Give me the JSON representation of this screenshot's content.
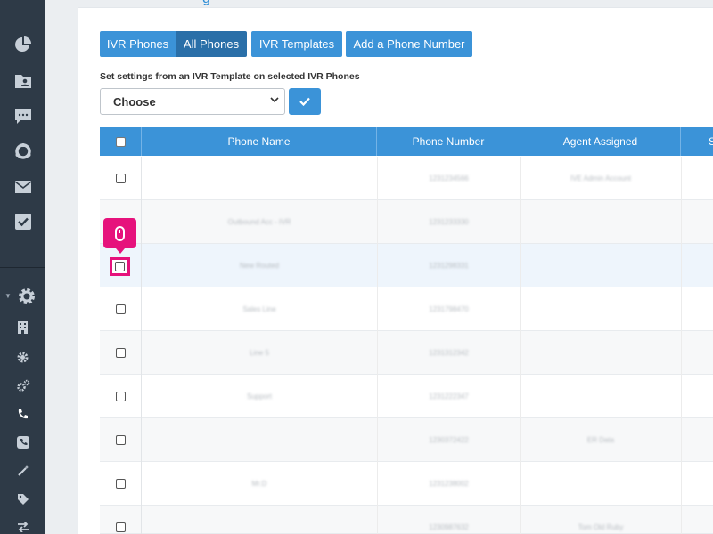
{
  "tabs": {
    "ivr_phones": "IVR Phones",
    "all_phones": "All Phones",
    "ivr_templates": "IVR Templates",
    "add_phone": "Add a Phone Number"
  },
  "settings": {
    "label": "Set settings from an IVR Template on selected IVR Phones",
    "select_value": "Choose"
  },
  "table": {
    "columns": [
      "Phone Name",
      "Phone Number",
      "Agent Assigned",
      "S"
    ],
    "rows": [
      {
        "name": "",
        "number": "1231234566",
        "agent": "IVE Admin Account"
      },
      {
        "name": "Outbound Acc - IVR",
        "number": "1231233330",
        "agent": ""
      },
      {
        "name": "New Routed",
        "number": "1231298331",
        "agent": ""
      },
      {
        "name": "Sales Line",
        "number": "1231798470",
        "agent": ""
      },
      {
        "name": "Line 5",
        "number": "1231312342",
        "agent": ""
      },
      {
        "name": "Support",
        "number": "1231222347",
        "agent": ""
      },
      {
        "name": "",
        "number": "1230372422",
        "agent": "ER Data"
      },
      {
        "name": "Mr.D",
        "number": "1231238002",
        "agent": ""
      },
      {
        "name": "",
        "number": "1230987632",
        "agent": "Tom Old Ruby"
      }
    ]
  },
  "sidebar": {
    "icons": [
      "pie-chart-icon",
      "contacts-folder-icon",
      "chat-icon",
      "lifebuoy-icon",
      "mail-icon",
      "checkbox-icon",
      "gear-icon",
      "building-icon",
      "small-gear-icon",
      "gears-icon",
      "phone-icon",
      "phone-square-icon",
      "magic-wand-icon",
      "tag-icon",
      "transfer-icon"
    ]
  },
  "colors": {
    "sidebar": "#2e3a47",
    "primary": "#3b93d8",
    "active_tab": "#2a6fa8",
    "marker": "#e6127c"
  }
}
